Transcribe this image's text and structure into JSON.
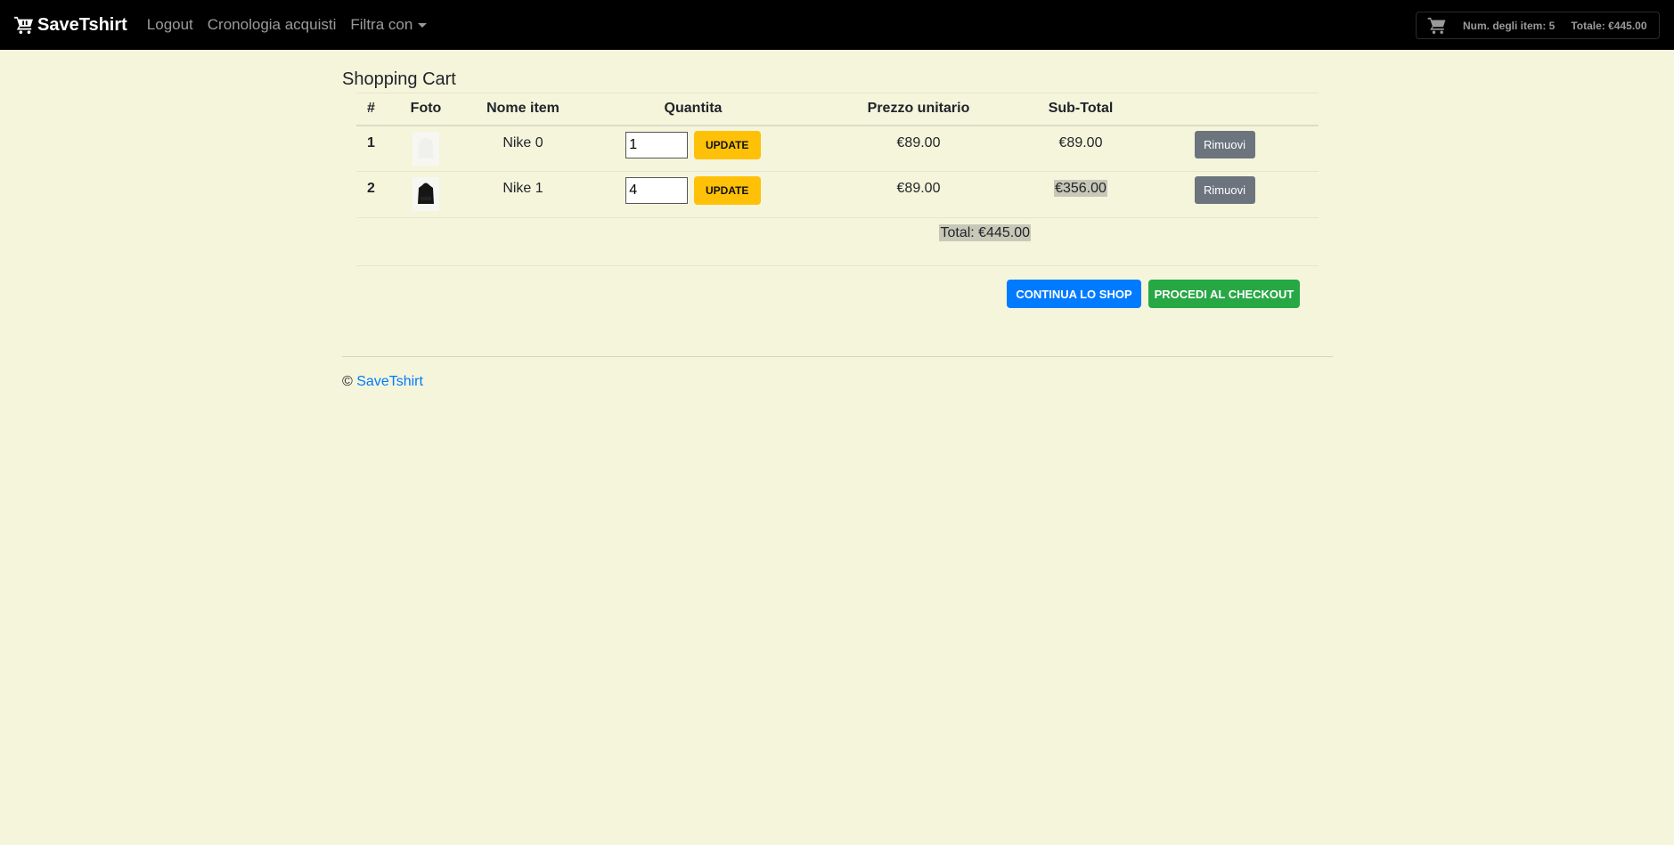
{
  "navbar": {
    "brand": "SaveTshirt",
    "links": [
      "Logout",
      "Cronologia acquisti",
      "Filtra con"
    ],
    "cart": {
      "count_label": "Num. degli item: 5",
      "total_label": "Totale: €445.00"
    }
  },
  "page_title": "Shopping Cart",
  "table": {
    "headers": [
      "#",
      "Foto",
      "Nome item",
      "Quantita",
      "Prezzo unitario",
      "Sub-Total"
    ],
    "rows": [
      {
        "num": "1",
        "name": "Nike 0",
        "qty": "1",
        "unit_price": "€89.00",
        "subtotal": "€89.00",
        "update_label": "UPDATE",
        "remove_label": "Rimuovi"
      },
      {
        "num": "2",
        "name": "Nike 1",
        "qty": "4",
        "unit_price": "€89.00",
        "subtotal": "€356.00",
        "update_label": "UPDATE",
        "remove_label": "Rimuovi"
      }
    ],
    "total": "Total: €445.00"
  },
  "actions": {
    "continue": "CONTINUA LO SHOP",
    "checkout": "PROCEDI AL CHECKOUT"
  },
  "footer": {
    "copyright": "©",
    "link": "SaveTshirt"
  }
}
